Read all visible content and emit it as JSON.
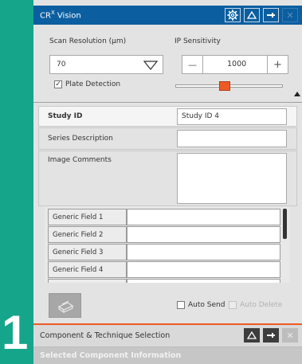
{
  "app": {
    "step_number": "1"
  },
  "window": {
    "title": "CR",
    "title_sup": "X",
    "title_suffix": " Vision"
  },
  "scan": {
    "resolution_label": "Scan Resolution (μm)",
    "resolution_value": "70",
    "ip_sensitivity_label": "IP Sensitivity",
    "ip_sensitivity_value": "1000",
    "minus_label": "—",
    "plus_label": "+",
    "plate_detection_label": "Plate Detection",
    "plate_detection_checked": true
  },
  "form": {
    "study_id_label": "Study ID",
    "study_id_value": "Study ID 4",
    "series_description_label": "Series Description",
    "series_description_value": "",
    "image_comments_label": "Image Comments",
    "image_comments_value": ""
  },
  "generic_fields": [
    {
      "label": "Generic Field 1",
      "value": ""
    },
    {
      "label": "Generic Field 2",
      "value": ""
    },
    {
      "label": "Generic Field 3",
      "value": ""
    },
    {
      "label": "Generic Field 4",
      "value": ""
    },
    {
      "label": "",
      "value": ""
    }
  ],
  "bottom": {
    "auto_send_label": "Auto Send",
    "auto_delete_label": "Auto Delete"
  },
  "component_panel": {
    "title": "Component & Technique Selection",
    "section_header": "Selected Component Information"
  },
  "colors": {
    "accent": "#ee5a24",
    "title_bar": "#0b5fa0",
    "background": "#15a58b"
  }
}
